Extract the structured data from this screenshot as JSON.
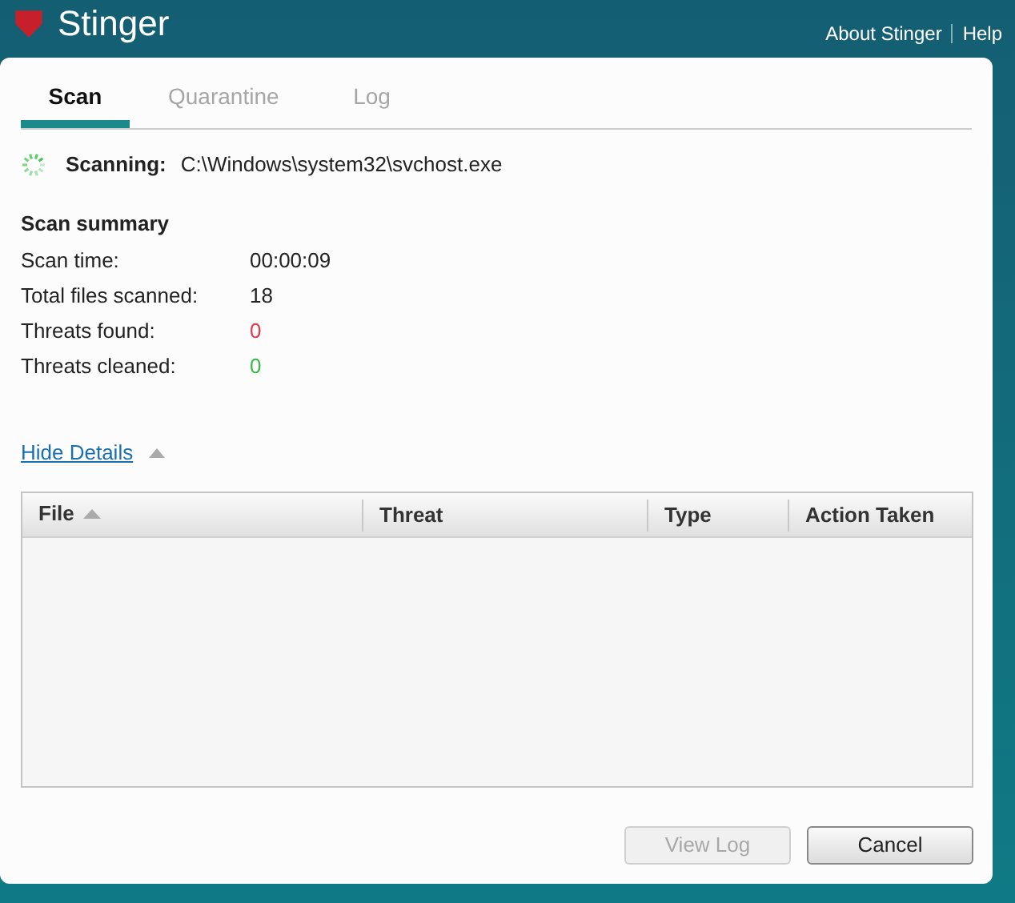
{
  "window": {
    "title": "Stinger"
  },
  "header_links": [
    "About Stinger",
    "Help"
  ],
  "tabs": [
    {
      "label": "Scan",
      "selected": true,
      "disabled": false
    },
    {
      "label": "Quarantine",
      "selected": false,
      "disabled": true
    },
    {
      "label": "Log",
      "selected": false,
      "disabled": true
    }
  ],
  "status": {
    "label": "Scanning:",
    "path": "C:\\Windows\\system32\\svchost.exe"
  },
  "summary": {
    "title": "Scan summary",
    "rows": [
      {
        "label": "Scan time:",
        "value": "00:00:09",
        "color": "#222222"
      },
      {
        "label": "Total files scanned:",
        "value": "18",
        "color": "#222222"
      },
      {
        "label": "Threats found:",
        "value": "0",
        "color": "#e2394a"
      },
      {
        "label": "Threats cleaned:",
        "value": "0",
        "color": "#3cb84a"
      }
    ]
  },
  "details_toggle": {
    "label": "Hide Details",
    "expanded": true
  },
  "table": {
    "columns": [
      {
        "label": "File",
        "sorted": true
      },
      {
        "label": "Threat",
        "sorted": false
      },
      {
        "label": "Type",
        "sorted": false
      },
      {
        "label": "Action Taken",
        "sorted": false
      }
    ]
  },
  "buttons": [
    {
      "label": "View Log",
      "disabled": true
    },
    {
      "label": "Cancel",
      "disabled": false
    }
  ]
}
